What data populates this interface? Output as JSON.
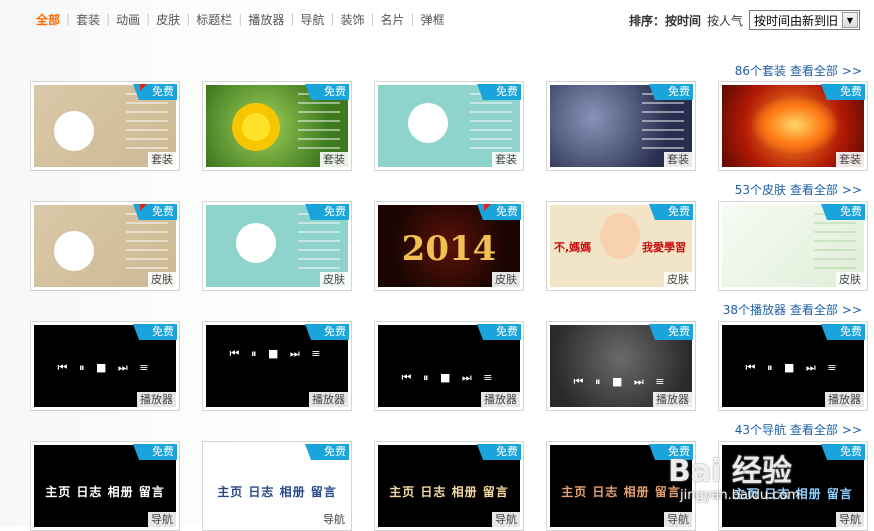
{
  "nav": {
    "items": [
      "全部",
      "套装",
      "动画",
      "皮肤",
      "标题栏",
      "播放器",
      "导航",
      "装饰",
      "名片",
      "弹框"
    ],
    "active": 0
  },
  "sort": {
    "label": "排序：",
    "options": [
      "按时间",
      "按人气"
    ],
    "select_value": "按时间由新到旧"
  },
  "sections": [
    {
      "count_label": "86个套装",
      "view_all": "查看全部",
      "more": ">>"
    },
    {
      "count_label": "53个皮肤",
      "view_all": "查看全部",
      "more": ">>"
    },
    {
      "count_label": "38个播放器",
      "view_all": "查看全部",
      "more": ">>"
    },
    {
      "count_label": "43个导航",
      "view_all": "查看全部",
      "more": ">>"
    }
  ],
  "badge_text": "免费",
  "rows": [
    [
      "套装",
      "套装",
      "套装",
      "套装",
      "套装"
    ],
    [
      "皮肤",
      "皮肤",
      "皮肤",
      "皮肤",
      "皮肤"
    ],
    [
      "播放器",
      "播放器",
      "播放器",
      "播放器",
      "播放器"
    ],
    [
      "导航",
      "导航",
      "导航",
      "导航",
      "导航"
    ]
  ],
  "thumb_text": {
    "year": "2014",
    "girl_left": "不,媽媽",
    "girl_right": "我愛學習",
    "player_controls": "⏮ ⏸ ■ ⏭ ≡",
    "nav_items": "主页 日志 相册 留言"
  },
  "watermark": {
    "main": "Bai 经验",
    "url": "jingyan.baidu.com"
  },
  "colors": {
    "active": "#ff6a00",
    "link": "#1f5fa6",
    "badge": "#1aa4dc"
  }
}
